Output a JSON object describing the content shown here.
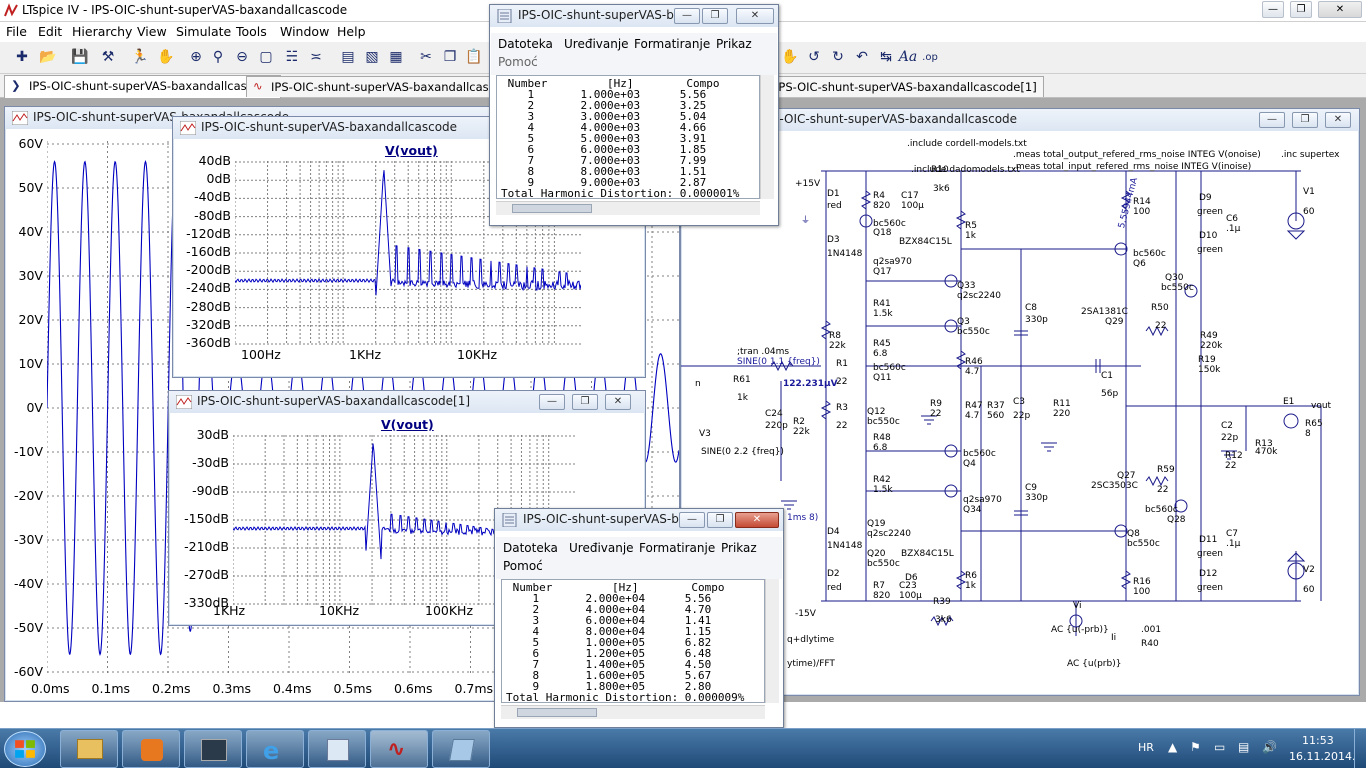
{
  "app": {
    "title": "LTspice IV - IPS-OIC-shunt-superVAS-baxandallcascode"
  },
  "menu": [
    "File",
    "Edit",
    "Hierarchy",
    "View",
    "Simulate",
    "Tools",
    "Window",
    "Help"
  ],
  "tabs": [
    {
      "label": "IPS-OIC-shunt-superVAS-baxandallcascode"
    },
    {
      "label": "IPS-OIC-shunt-superVAS-baxandallcascode"
    },
    {
      "label": "IPS-OIC-shunt-superVAS-baxandallcascode[1]"
    }
  ],
  "windows": {
    "transient": {
      "title": "IPS-OIC-shunt-superVAS-baxandallcascode",
      "y_ticks": [
        "60V",
        "50V",
        "40V",
        "30V",
        "20V",
        "10V",
        "0V",
        "-10V",
        "-20V",
        "-30V",
        "-40V",
        "-50V",
        "-60V"
      ],
      "x_ticks": [
        "0.0ms",
        "0.1ms",
        "0.2ms",
        "0.3ms",
        "0.4ms",
        "0.5ms",
        "0.6ms",
        "0.7ms"
      ]
    },
    "fft1": {
      "title": "IPS-OIC-shunt-superVAS-baxandallcascode",
      "trace": "V(vout)",
      "y_ticks": [
        "40dB",
        "0dB",
        "-40dB",
        "-80dB",
        "-120dB",
        "-160dB",
        "-200dB",
        "-240dB",
        "-280dB",
        "-320dB",
        "-360dB"
      ],
      "x_ticks": [
        "100Hz",
        "1KHz",
        "10KHz"
      ]
    },
    "fft2": {
      "title": "IPS-OIC-shunt-superVAS-baxandallcascode[1]",
      "trace": "V(vout)",
      "y_ticks": [
        "30dB",
        "-30dB",
        "-90dB",
        "-150dB",
        "-210dB",
        "-270dB",
        "-330dB"
      ],
      "x_ticks": [
        "1KHz",
        "10KHz",
        "100KHz"
      ]
    },
    "schematic": {
      "title": "IPS-OIC-shunt-superVAS-baxandallcascode",
      "directives": [
        ".include cordell-models.txt",
        ".meas total_output_refered_rms_noise INTEG V(onoise)",
        ".meas total_input_refered_rms_noise INTEG V(inoise)",
        ".include dadomodels.txt",
        ".inc supertex"
      ],
      "labels": {
        "p15": "+15V",
        "m15": "-15V",
        "D1": "D1",
        "red1": "red",
        "R4": "R4",
        "r4v": "820",
        "C17": "C17",
        "c17v": "100µ",
        "R10": "R10",
        "r10v": "3k6",
        "R14": "R14",
        "r14v": "100",
        "D9": "D9",
        "green9": "green",
        "C6": "C6",
        "c6v": ".1µ",
        "V1": "V1",
        "v1v": "60",
        "bc560c_a": "bc560c",
        "Q18": "Q18",
        "R5": "R5",
        "r5v": "1k",
        "D3": "D3",
        "bzx1": "BZX84C15L",
        "idraw": "5.55944mA",
        "D10": "D10",
        "green10": "green",
        "n4148a": "1N4148",
        "q2sa970a": "q2sa970",
        "Q17": "Q17",
        "bc560c_b": "bc560c",
        "Q6": "Q6",
        "Q30": "Q30",
        "bc550c_a": "bc550c",
        "Q33": "Q33",
        "q2sc2240a": "q2sc2240",
        "R41": "R41",
        "r41v": "1.5k",
        "C8": "C8",
        "c8v": "330p",
        "sa1381": "2SA1381C",
        "Q29": "Q29",
        "R50": "R50",
        "r50v": "22",
        "R49": "R49",
        "r49v": "220k",
        "Q3": "Q3",
        "bc550c_b": "bc550c",
        "R8": "R8",
        "r8v": "22k",
        "R45": "R45",
        "r45v": "6.8",
        "R19": "R19",
        "r19v": "150k",
        "tran": ";tran .04ms",
        "sine1": "SINE(0 1.1 {freq})",
        "R1": "R1",
        "r1v": "22",
        "bc560c_c": "bc560c",
        "Q11": "Q11",
        "R46": "R46",
        "r46v": "4.7",
        "nin": "n",
        "R61": "R61",
        "r61v": "1k",
        "vmeas": "122.231µV",
        "C1": "C1",
        "c1v": "56p",
        "R11": "R11",
        "r11v": "220",
        "vout": "vout",
        "E1": "E1",
        "R9": "R9",
        "r9v": "22",
        "R47": "R47",
        "r47v": "4.7",
        "R37": "R37",
        "r37v": "560",
        "C3": "C3",
        "c3v": "22p",
        "R65": "R65",
        "r65v": "8",
        "R3": "R3",
        "r3v": "22",
        "Q12": "Q12",
        "bc550c_c": "bc550c",
        "C24": "C24",
        "c24v": "220p",
        "R2": "R2",
        "r2v": "22k",
        "V3": "V3",
        "C2": "C2",
        "c2v": "22p",
        "R13": "R13",
        "r13v": "470k",
        "R48": "R48",
        "r48v": "6.8",
        "R12": "R12",
        "r12v": "22",
        "sine2": "SINE(0 2.2 {freq})",
        "bc560c_d": "bc560c",
        "Q4": "Q4",
        "C9": "C9",
        "c9v": "330p",
        "R42": "R42",
        "r42v": "1.5k",
        "Q27": "Q27",
        "sc3503": "2SC3503C",
        "R59": "R59",
        "r59v": "22",
        "q2sa970b": "q2sa970",
        "Q34": "Q34",
        "bc560c_e": "bc560c",
        "Q28": "Q28",
        "Q19": "Q19",
        "q2sc2240b": "q2sc2240",
        "Q8": "Q8",
        "bc550c_d": "bc550c",
        "D4": "D4",
        "n4148b": "1N4148",
        "Q20": "Q20",
        "bc550c_e": "bc550c",
        "bzx2": "BZX84C15L",
        "C7": "C7",
        "c7v": ".1µ",
        "D11": "D11",
        "green11": "green",
        "D6": "D6",
        "R6": "R6",
        "r6v": "1k",
        "V2": "V2",
        "v2v": "60",
        "D2": "D2",
        "red2": "red",
        "R7": "R7",
        "r7v": "820",
        "C23": "C23",
        "c23v": "100µ",
        "D12": "D12",
        "green12": "green",
        "R16": "R16",
        "r16v": "100",
        "R39": "R39",
        "r39v": "3k6",
        "R40": "R40",
        "r40v": ".001",
        "Vi": "Vi",
        "ac1": "AC {u(-prb)}",
        "Ii": "Ii",
        "ac2": "AC {u(prb)}",
        "dly": "q+dlytime",
        "fftfrag": "ytime)/FFT",
        "ms8": "1ms 8)"
      }
    }
  },
  "fft_dialog_top": {
    "title": "IPS-OIC-shunt-superVAS-b...",
    "menu": [
      "Datoteka",
      "Uređivanje",
      "Formatiranje",
      "Prikaz",
      "Pomoć"
    ],
    "header": " Number         [Hz]        Compo",
    "rows": [
      "    1       1.000e+03      5.56",
      "    2       2.000e+03      3.25",
      "    3       3.000e+03      5.04",
      "    4       4.000e+03      4.66",
      "    5       5.000e+03      3.91",
      "    6       6.000e+03      1.85",
      "    7       7.000e+03      7.99",
      "    8       8.000e+03      1.51",
      "    9       9.000e+03      2.87"
    ],
    "thd": "Total Harmonic Distortion: 0.000001%"
  },
  "fft_dialog_bottom": {
    "title": "IPS-OIC-shunt-superVAS-b...",
    "menu": [
      "Datoteka",
      "Uređivanje",
      "Formatiranje",
      "Prikaz",
      "Pomoć"
    ],
    "header": " Number         [Hz]        Compo",
    "rows": [
      "    1       2.000e+04      5.56",
      "    2       4.000e+04      4.70",
      "    3       6.000e+04      1.41",
      "    4       8.000e+04      1.15",
      "    5       1.000e+05      6.82",
      "    6       1.200e+05      6.48",
      "    7       1.400e+05      4.50",
      "    8       1.600e+05      5.67",
      "    9       1.800e+05      2.80"
    ],
    "thd": "Total Harmonic Distortion: 0.000009%"
  },
  "taskbar": {
    "lang": "HR",
    "time": "11:53",
    "date": "16.11.2014."
  },
  "colors": {
    "trace": "#0000c0",
    "grid": "#808080",
    "schematic_wire": "#1a1a8a",
    "taskbar": "#2a5a8a"
  }
}
